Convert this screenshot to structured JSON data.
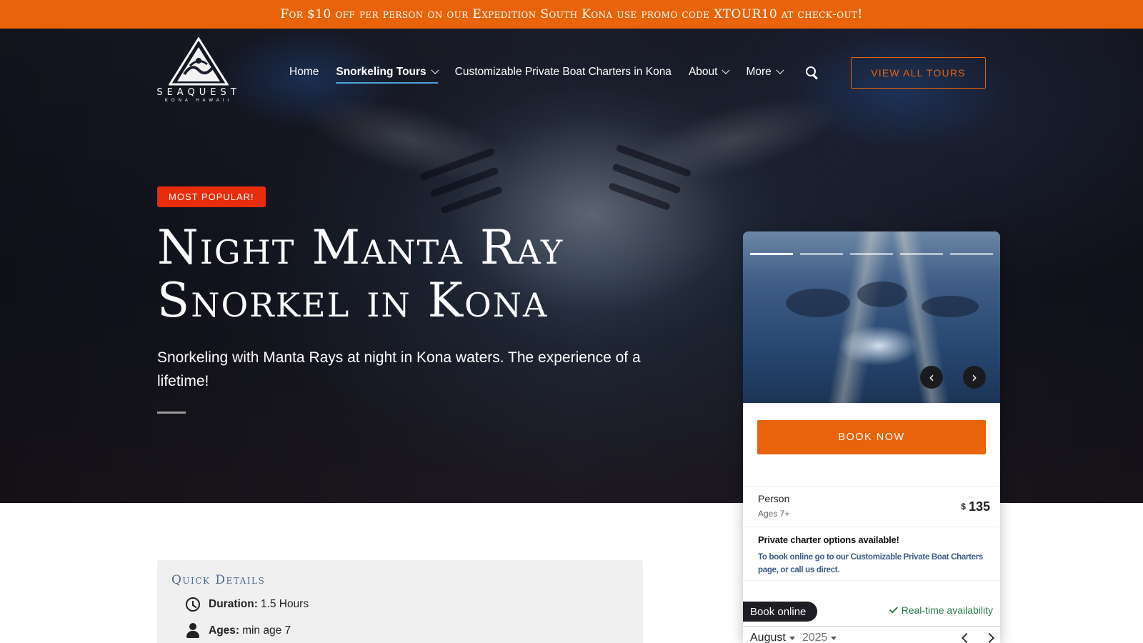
{
  "promo": {
    "text": "For $10 off per person on our Expedition South Kona use promo code XTOUR10 at check-out!"
  },
  "brand": {
    "name": "SEAQUEST",
    "tagline": "KONA HAWAII"
  },
  "nav": {
    "items": [
      {
        "label": "Home",
        "dropdown": false,
        "active": false
      },
      {
        "label": "Snorkeling Tours",
        "dropdown": true,
        "active": true
      },
      {
        "label": "Customizable Private Boat Charters in Kona",
        "dropdown": false,
        "active": false
      },
      {
        "label": "About",
        "dropdown": true,
        "active": false
      },
      {
        "label": "More",
        "dropdown": true,
        "active": false
      }
    ],
    "search_icon": "search-icon",
    "cta_label": "VIEW ALL TOURS"
  },
  "hero": {
    "badge": "MOST POPULAR!",
    "title_line1": "Night Manta Ray",
    "title_line2": "Snorkel in Kona",
    "subtitle": "Snorkeling with Manta Rays at night in Kona waters. The experience of a lifetime!"
  },
  "booking": {
    "carousel": {
      "slide_count": 5,
      "active_slide": 1,
      "prev_symbol": "‹",
      "next_symbol": "›"
    },
    "book_now_label": "BOOK NOW",
    "price": {
      "label": "Person",
      "ages": "Ages 7+",
      "currency": "$",
      "amount": "135"
    },
    "charter": {
      "heading": "Private charter options available!",
      "text": "To book online go to our Customizable Private Boat Charters page, or call us direct."
    },
    "book_online_label": "Book online",
    "realtime_label": "Real-time availability",
    "calendar": {
      "month": "August",
      "year": "2025"
    }
  },
  "quick_details": {
    "heading": "Quick Details",
    "duration_label": "Duration:",
    "duration_value": "1.5 Hours",
    "ages_label": "Ages:",
    "ages_value": "min age 7"
  },
  "colors": {
    "accent": "#e8630a",
    "badge": "#e82d0c",
    "nav_underline": "#4fa3d9",
    "dark": "#1d1d24",
    "realtime": "#2a7a4b"
  }
}
